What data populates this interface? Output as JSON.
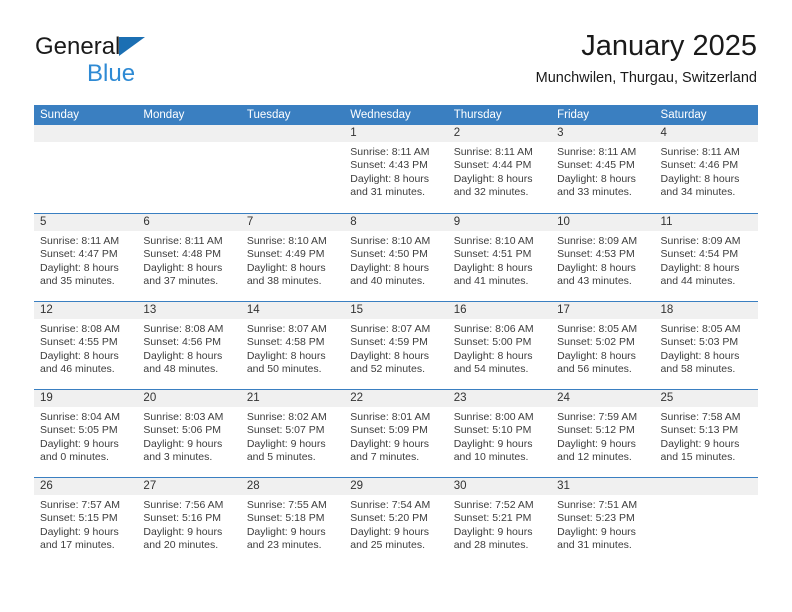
{
  "brand": {
    "name_top": "General",
    "name_bottom": "Blue",
    "triangle_color": "#1b6fb3",
    "blue_text_color": "#2e8ad4"
  },
  "header": {
    "title": "January 2025",
    "subtitle": "Munchwilen, Thurgau, Switzerland"
  },
  "theme": {
    "header_bar_color": "#3a7fc1",
    "day_strip_color": "#f0f0f0",
    "row_divider_color": "#3a7fc1"
  },
  "weekday_headers": [
    "Sunday",
    "Monday",
    "Tuesday",
    "Wednesday",
    "Thursday",
    "Friday",
    "Saturday"
  ],
  "labels": {
    "sunrise_prefix": "Sunrise:",
    "sunset_prefix": "Sunset:",
    "daylight_prefix": "Daylight:"
  },
  "weeks": [
    [
      {
        "day": "",
        "empty": true,
        "line1": "",
        "line2": "",
        "line3": "",
        "line4": ""
      },
      {
        "day": "",
        "empty": true,
        "line1": "",
        "line2": "",
        "line3": "",
        "line4": ""
      },
      {
        "day": "",
        "empty": true,
        "line1": "",
        "line2": "",
        "line3": "",
        "line4": ""
      },
      {
        "day": "1",
        "empty": false,
        "line1": "Sunrise: 8:11 AM",
        "line2": "Sunset: 4:43 PM",
        "line3": "Daylight: 8 hours",
        "line4": "and 31 minutes."
      },
      {
        "day": "2",
        "empty": false,
        "line1": "Sunrise: 8:11 AM",
        "line2": "Sunset: 4:44 PM",
        "line3": "Daylight: 8 hours",
        "line4": "and 32 minutes."
      },
      {
        "day": "3",
        "empty": false,
        "line1": "Sunrise: 8:11 AM",
        "line2": "Sunset: 4:45 PM",
        "line3": "Daylight: 8 hours",
        "line4": "and 33 minutes."
      },
      {
        "day": "4",
        "empty": false,
        "line1": "Sunrise: 8:11 AM",
        "line2": "Sunset: 4:46 PM",
        "line3": "Daylight: 8 hours",
        "line4": "and 34 minutes."
      }
    ],
    [
      {
        "day": "5",
        "empty": false,
        "line1": "Sunrise: 8:11 AM",
        "line2": "Sunset: 4:47 PM",
        "line3": "Daylight: 8 hours",
        "line4": "and 35 minutes."
      },
      {
        "day": "6",
        "empty": false,
        "line1": "Sunrise: 8:11 AM",
        "line2": "Sunset: 4:48 PM",
        "line3": "Daylight: 8 hours",
        "line4": "and 37 minutes."
      },
      {
        "day": "7",
        "empty": false,
        "line1": "Sunrise: 8:10 AM",
        "line2": "Sunset: 4:49 PM",
        "line3": "Daylight: 8 hours",
        "line4": "and 38 minutes."
      },
      {
        "day": "8",
        "empty": false,
        "line1": "Sunrise: 8:10 AM",
        "line2": "Sunset: 4:50 PM",
        "line3": "Daylight: 8 hours",
        "line4": "and 40 minutes."
      },
      {
        "day": "9",
        "empty": false,
        "line1": "Sunrise: 8:10 AM",
        "line2": "Sunset: 4:51 PM",
        "line3": "Daylight: 8 hours",
        "line4": "and 41 minutes."
      },
      {
        "day": "10",
        "empty": false,
        "line1": "Sunrise: 8:09 AM",
        "line2": "Sunset: 4:53 PM",
        "line3": "Daylight: 8 hours",
        "line4": "and 43 minutes."
      },
      {
        "day": "11",
        "empty": false,
        "line1": "Sunrise: 8:09 AM",
        "line2": "Sunset: 4:54 PM",
        "line3": "Daylight: 8 hours",
        "line4": "and 44 minutes."
      }
    ],
    [
      {
        "day": "12",
        "empty": false,
        "line1": "Sunrise: 8:08 AM",
        "line2": "Sunset: 4:55 PM",
        "line3": "Daylight: 8 hours",
        "line4": "and 46 minutes."
      },
      {
        "day": "13",
        "empty": false,
        "line1": "Sunrise: 8:08 AM",
        "line2": "Sunset: 4:56 PM",
        "line3": "Daylight: 8 hours",
        "line4": "and 48 minutes."
      },
      {
        "day": "14",
        "empty": false,
        "line1": "Sunrise: 8:07 AM",
        "line2": "Sunset: 4:58 PM",
        "line3": "Daylight: 8 hours",
        "line4": "and 50 minutes."
      },
      {
        "day": "15",
        "empty": false,
        "line1": "Sunrise: 8:07 AM",
        "line2": "Sunset: 4:59 PM",
        "line3": "Daylight: 8 hours",
        "line4": "and 52 minutes."
      },
      {
        "day": "16",
        "empty": false,
        "line1": "Sunrise: 8:06 AM",
        "line2": "Sunset: 5:00 PM",
        "line3": "Daylight: 8 hours",
        "line4": "and 54 minutes."
      },
      {
        "day": "17",
        "empty": false,
        "line1": "Sunrise: 8:05 AM",
        "line2": "Sunset: 5:02 PM",
        "line3": "Daylight: 8 hours",
        "line4": "and 56 minutes."
      },
      {
        "day": "18",
        "empty": false,
        "line1": "Sunrise: 8:05 AM",
        "line2": "Sunset: 5:03 PM",
        "line3": "Daylight: 8 hours",
        "line4": "and 58 minutes."
      }
    ],
    [
      {
        "day": "19",
        "empty": false,
        "line1": "Sunrise: 8:04 AM",
        "line2": "Sunset: 5:05 PM",
        "line3": "Daylight: 9 hours",
        "line4": "and 0 minutes."
      },
      {
        "day": "20",
        "empty": false,
        "line1": "Sunrise: 8:03 AM",
        "line2": "Sunset: 5:06 PM",
        "line3": "Daylight: 9 hours",
        "line4": "and 3 minutes."
      },
      {
        "day": "21",
        "empty": false,
        "line1": "Sunrise: 8:02 AM",
        "line2": "Sunset: 5:07 PM",
        "line3": "Daylight: 9 hours",
        "line4": "and 5 minutes."
      },
      {
        "day": "22",
        "empty": false,
        "line1": "Sunrise: 8:01 AM",
        "line2": "Sunset: 5:09 PM",
        "line3": "Daylight: 9 hours",
        "line4": "and 7 minutes."
      },
      {
        "day": "23",
        "empty": false,
        "line1": "Sunrise: 8:00 AM",
        "line2": "Sunset: 5:10 PM",
        "line3": "Daylight: 9 hours",
        "line4": "and 10 minutes."
      },
      {
        "day": "24",
        "empty": false,
        "line1": "Sunrise: 7:59 AM",
        "line2": "Sunset: 5:12 PM",
        "line3": "Daylight: 9 hours",
        "line4": "and 12 minutes."
      },
      {
        "day": "25",
        "empty": false,
        "line1": "Sunrise: 7:58 AM",
        "line2": "Sunset: 5:13 PM",
        "line3": "Daylight: 9 hours",
        "line4": "and 15 minutes."
      }
    ],
    [
      {
        "day": "26",
        "empty": false,
        "line1": "Sunrise: 7:57 AM",
        "line2": "Sunset: 5:15 PM",
        "line3": "Daylight: 9 hours",
        "line4": "and 17 minutes."
      },
      {
        "day": "27",
        "empty": false,
        "line1": "Sunrise: 7:56 AM",
        "line2": "Sunset: 5:16 PM",
        "line3": "Daylight: 9 hours",
        "line4": "and 20 minutes."
      },
      {
        "day": "28",
        "empty": false,
        "line1": "Sunrise: 7:55 AM",
        "line2": "Sunset: 5:18 PM",
        "line3": "Daylight: 9 hours",
        "line4": "and 23 minutes."
      },
      {
        "day": "29",
        "empty": false,
        "line1": "Sunrise: 7:54 AM",
        "line2": "Sunset: 5:20 PM",
        "line3": "Daylight: 9 hours",
        "line4": "and 25 minutes."
      },
      {
        "day": "30",
        "empty": false,
        "line1": "Sunrise: 7:52 AM",
        "line2": "Sunset: 5:21 PM",
        "line3": "Daylight: 9 hours",
        "line4": "and 28 minutes."
      },
      {
        "day": "31",
        "empty": false,
        "line1": "Sunrise: 7:51 AM",
        "line2": "Sunset: 5:23 PM",
        "line3": "Daylight: 9 hours",
        "line4": "and 31 minutes."
      },
      {
        "day": "",
        "empty": true,
        "line1": "",
        "line2": "",
        "line3": "",
        "line4": ""
      }
    ]
  ]
}
